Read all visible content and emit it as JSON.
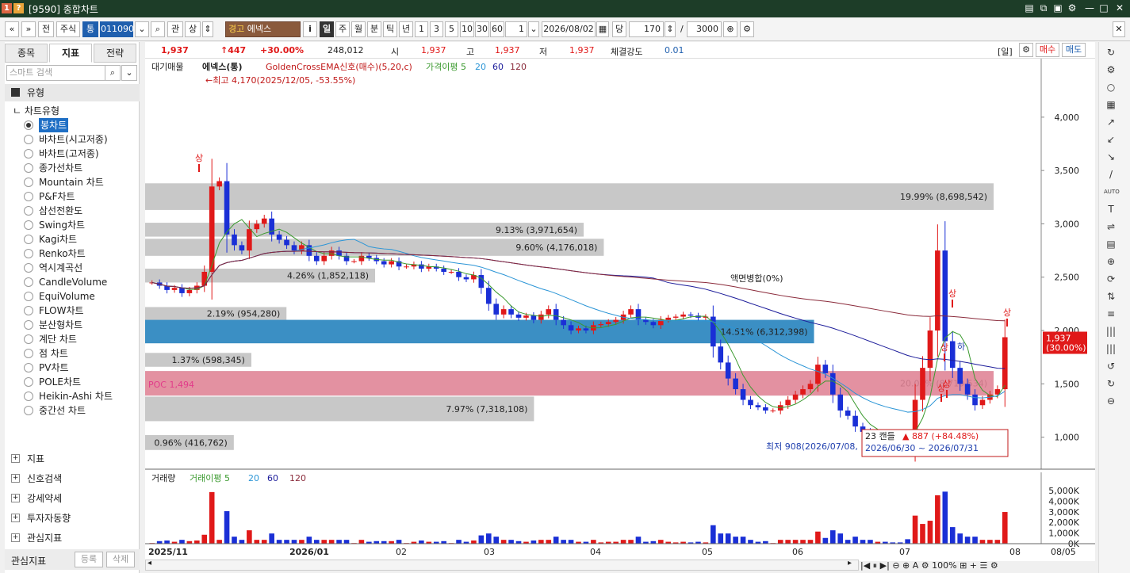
{
  "window": {
    "code": "[9590]",
    "title": "종합차트"
  },
  "toolbar": {
    "nav_prev": "«",
    "nav_down": "»",
    "market_btn": "전",
    "stock_type": "주식",
    "tong": "통",
    "code": "011090",
    "gwan": "관",
    "sang": "상",
    "warning": "경고",
    "stock_name": "에넥스",
    "info_btn": "i",
    "periods": [
      "일",
      "주",
      "월",
      "분",
      "틱",
      "년"
    ],
    "minutes": [
      "1",
      "3",
      "5",
      "10",
      "30",
      "60"
    ],
    "unit": "1",
    "date": "2026/08/02",
    "dang": "당",
    "count": "170",
    "slash": "/",
    "total": "3000"
  },
  "sidebar": {
    "tabs": [
      "종목",
      "지표",
      "전략"
    ],
    "search_placeholder": "스마트 검색",
    "section_type": "유형",
    "chart_type_header": "차트유형",
    "chart_types": [
      "봉차트",
      "바차트(시고저종)",
      "바차트(고저종)",
      "종가선차트",
      "Mountain 차트",
      "P&F차트",
      "삼선전환도",
      "Swing차트",
      "Kagi차트",
      "Renko차트",
      "역시계곡선",
      "CandleVolume",
      "EquiVolume",
      "FLOW차트",
      "분산형차트",
      "계단 차트",
      "점 차트",
      "PV차트",
      "POLE차트",
      "Heikin-Ashi 차트",
      "중간선 차트"
    ],
    "sections": [
      "지표",
      "신호검색",
      "강세약세",
      "투자자동향",
      "관심지표"
    ],
    "footer_label": "관심지표",
    "register": "등록",
    "delete": "삭제"
  },
  "infobar": {
    "price": "1,937",
    "change": "↑447",
    "change_pct": "+30.00%",
    "volume": "248,012",
    "open_label": "시",
    "open": "1,937",
    "high_label": "고",
    "high": "1,937",
    "low_label": "저",
    "low": "1,937",
    "strength_label": "체결강도",
    "strength": "0.01",
    "period_tag": "[일]",
    "buy": "매수",
    "sell": "매도"
  },
  "chart_data": {
    "type": "candlestick",
    "legend": [
      "대기매물",
      "에넥스(통)",
      "GoldenCrossEMA신호(매수)(5,20,c)",
      "가격이평 5",
      "20",
      "60",
      "120"
    ],
    "y_ticks": [
      "4,000",
      "3,500",
      "3,000",
      "2,500",
      "2,000",
      "1,500",
      "1,000"
    ],
    "ylim": [
      700,
      4400
    ],
    "x_labels": [
      "2025/11",
      "2026/01",
      "02",
      "03",
      "04",
      "05",
      "06",
      "07",
      "08",
      "08/05"
    ],
    "volume_profile": [
      {
        "label": "19.99% (8,698,542)",
        "low": 3130,
        "high": 3380
      },
      {
        "label": "9.13% (3,971,654)",
        "low": 2880,
        "high": 3010
      },
      {
        "label": "9.60% (4,176,018)",
        "low": 2700,
        "high": 2860
      },
      {
        "label": "4.26% (1,852,118)",
        "low": 2450,
        "high": 2580
      },
      {
        "label": "2.19% (954,280)",
        "low": 2100,
        "high": 2220
      },
      {
        "label": "14.51% (6,312,398)",
        "low": 1880,
        "high": 2100
      },
      {
        "label": "1.37% (598,345)",
        "low": 1660,
        "high": 1790
      },
      {
        "label": "20.04% (8,719,534)",
        "low": 1390,
        "high": 1620
      },
      {
        "label": "7.97% (7,318,108)",
        "low": 1150,
        "high": 1380
      },
      {
        "label": "0.96% (416,762)",
        "low": 880,
        "high": 1020
      }
    ],
    "poc": {
      "label": "POC 1,494",
      "value": 1494
    },
    "annotations": {
      "high": "←최고 4,170(2025/12/05, -53.55%)",
      "low": "최저 908(2026/07/08,",
      "split": "액면병합(0%)",
      "signal_up": "상",
      "signal_down": "하",
      "tooltip_candles": "23 캔들",
      "tooltip_change": "▲ 887 (+84.48%)",
      "tooltip_range": "2026/06/30 ~ 2026/07/31"
    },
    "last_price": "1,937",
    "last_price_pct": "(30.00%)",
    "closes": [
      2450,
      2420,
      2380,
      2400,
      2350,
      2380,
      2420,
      2550,
      3350,
      3400,
      2900,
      2800,
      2750,
      2950,
      3000,
      3050,
      2900,
      2850,
      2800,
      2750,
      2800,
      2700,
      2650,
      2700,
      2750,
      2700,
      2650,
      2650,
      2700,
      2680,
      2650,
      2620,
      2650,
      2600,
      2600,
      2620,
      2580,
      2600,
      2580,
      2550,
      2550,
      2500,
      2480,
      2520,
      2400,
      2250,
      2150,
      2200,
      2150,
      2120,
      2140,
      2100,
      2150,
      2200,
      2100,
      2050,
      2000,
      2020,
      2000,
      2050,
      2060,
      2080,
      2100,
      2150,
      2200,
      2100,
      2080,
      2050,
      2100,
      2120,
      2130,
      2150,
      2140,
      2120,
      2130,
      1850,
      1700,
      1550,
      1450,
      1350,
      1300,
      1280,
      1250,
      1250,
      1300,
      1350,
      1400,
      1450,
      1500,
      1680,
      1600,
      1400,
      1250,
      1200,
      1100,
      1050,
      1000,
      1020,
      1000,
      990,
      980,
      920,
      1350,
      1650,
      2000,
      2750,
      1900,
      1650,
      1500,
      1400,
      1300,
      1350,
      1400,
      1450,
      1937
    ],
    "volume_ticks": [
      "5,000K",
      "4,000K",
      "3,000K",
      "2,000K",
      "1,000K",
      "0K"
    ],
    "volume_legend": [
      "거래량",
      "거래이평 5",
      "20",
      "60",
      "120"
    ]
  },
  "right_tools": [
    "↻",
    "⚙",
    "○",
    "▦",
    "↗",
    "↙",
    "↘",
    "/",
    "AUTO",
    "T",
    "⇌",
    "▤",
    "⊕",
    "⟳",
    "⇅",
    "≡",
    "|||",
    "|||",
    "↺",
    "↻",
    "⊖"
  ],
  "bottom_controls": "|◀ ⏸ ▶| ⊖ ⊕ A ⚙ 100% ⊞ + ☰ ⚙"
}
